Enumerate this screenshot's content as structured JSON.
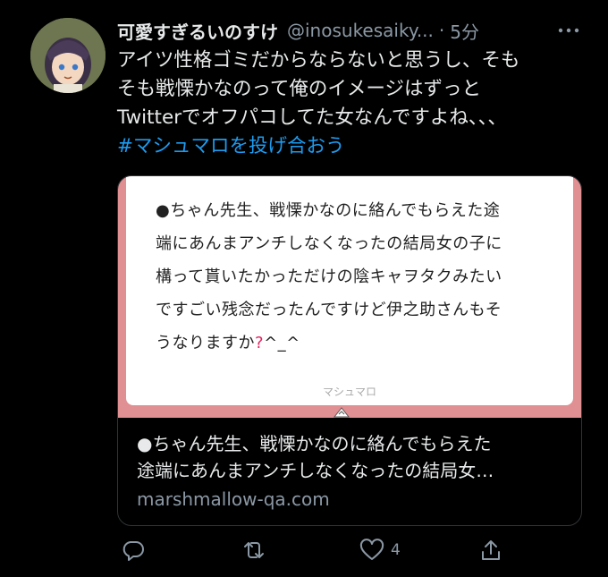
{
  "tweet": {
    "display_name": "可愛すぎるいのすけ",
    "handle": "@inosukesaiky...",
    "separator": "·",
    "time": "5分",
    "text_lines": [
      "アイツ性格ゴミだからならないと思うし、そも",
      "そも戦慄かなのって俺のイメージはずっと",
      "Twitterでオフパコしてた女なんですよね、、、"
    ],
    "hashtag": "#マシュマロを投げ合おう"
  },
  "card": {
    "question_lines": [
      "●ちゃん先生、戦慄かなのに絡んでもらえた途",
      "端にあんまアンチしなくなったの結局女の子に",
      "構って貰いたかっただけの陰キャヲタクみたい",
      "ですごい残念だったんですけど伊之助さんもそ",
      "うなりますか"
    ],
    "question_end": "^_^",
    "question_mark": "?",
    "brand": "マシュマロ",
    "title_lines": [
      "●ちゃん先生、戦慄かなのに絡んでもらえた",
      "途端にあんまアンチしなくなったの結局女…"
    ],
    "domain": "marshmallow-qa.com"
  },
  "actions": {
    "like_count": "4"
  },
  "icons": {
    "more": "more-dots-icon",
    "reply": "reply-icon",
    "retweet": "retweet-icon",
    "like": "heart-icon",
    "share": "share-icon"
  },
  "colors": {
    "background": "#000000",
    "text": "#e7e9ea",
    "secondary": "#8b98a5",
    "link": "#1d9bf0",
    "card_frame": "#e08f93"
  }
}
